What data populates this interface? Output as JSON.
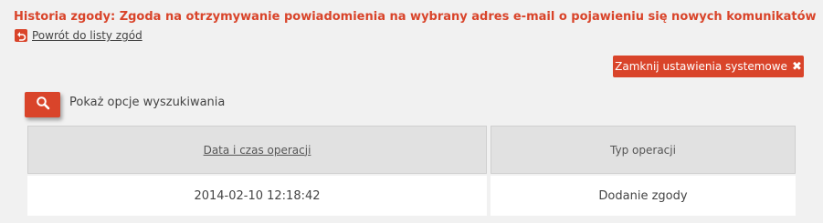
{
  "header": {
    "title": "Historia zgody: Zgoda na otrzymywanie powiadomienia na wybrany adres e-mail o pojawieniu się nowych komunikatów",
    "back_link": "Powrót do listy zgód",
    "back_icon": "undo-arrow-icon"
  },
  "toolbar": {
    "close_label": "Zamknij ustawienia systemowe",
    "close_icon": "close-icon"
  },
  "search": {
    "icon": "search-icon",
    "label": "Pokaż opcje wyszukiwania"
  },
  "table": {
    "columns": [
      "Data i czas operacji",
      "Typ operacji"
    ],
    "rows": [
      [
        "2014-02-10 12:18:42",
        "Dodanie zgody"
      ]
    ]
  },
  "colors": {
    "accent": "#d9442a",
    "background": "#f1f1f1",
    "header_bg": "#e1e1e1"
  }
}
